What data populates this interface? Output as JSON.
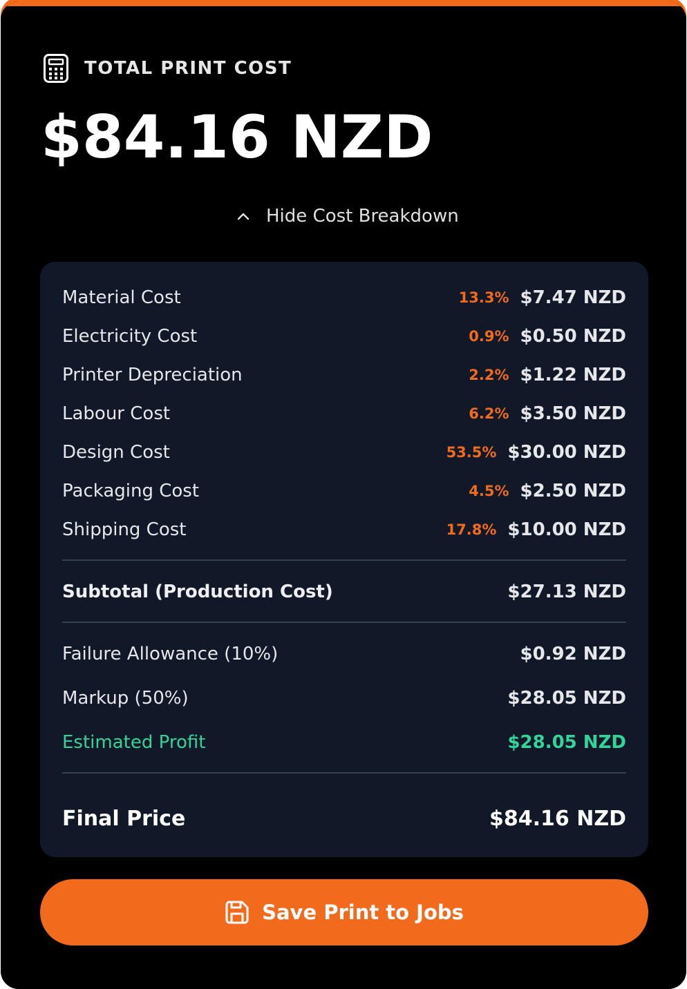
{
  "header": {
    "icon": "calculator-icon",
    "label": "TOTAL PRINT COST",
    "total": "$84.16 NZD"
  },
  "toggle": {
    "icon": "chevron-up-icon",
    "label": "Hide Cost Breakdown"
  },
  "breakdown": {
    "items": [
      {
        "label": "Material Cost",
        "percent": "13.3%",
        "amount": "$7.47 NZD"
      },
      {
        "label": "Electricity Cost",
        "percent": "0.9%",
        "amount": "$0.50 NZD"
      },
      {
        "label": "Printer Depreciation",
        "percent": "2.2%",
        "amount": "$1.22 NZD"
      },
      {
        "label": "Labour Cost",
        "percent": "6.2%",
        "amount": "$3.50 NZD"
      },
      {
        "label": "Design Cost",
        "percent": "53.5%",
        "amount": "$30.00 NZD"
      },
      {
        "label": "Packaging Cost",
        "percent": "4.5%",
        "amount": "$2.50 NZD"
      },
      {
        "label": "Shipping Cost",
        "percent": "17.8%",
        "amount": "$10.00 NZD"
      }
    ],
    "subtotal": {
      "label": "Subtotal (Production Cost)",
      "amount": "$27.13 NZD"
    },
    "failure": {
      "label": "Failure Allowance (10%)",
      "amount": "$0.92 NZD"
    },
    "markup": {
      "label": "Markup (50%)",
      "amount": "$28.05 NZD"
    },
    "profit": {
      "label": "Estimated Profit",
      "amount": "$28.05 NZD"
    },
    "final": {
      "label": "Final Price",
      "amount": "$84.16 NZD"
    }
  },
  "save_button": {
    "icon": "save-icon",
    "label": "Save Print to Jobs"
  },
  "colors": {
    "accent": "#f26b1d",
    "panel": "#111827",
    "profit": "#34d399"
  }
}
